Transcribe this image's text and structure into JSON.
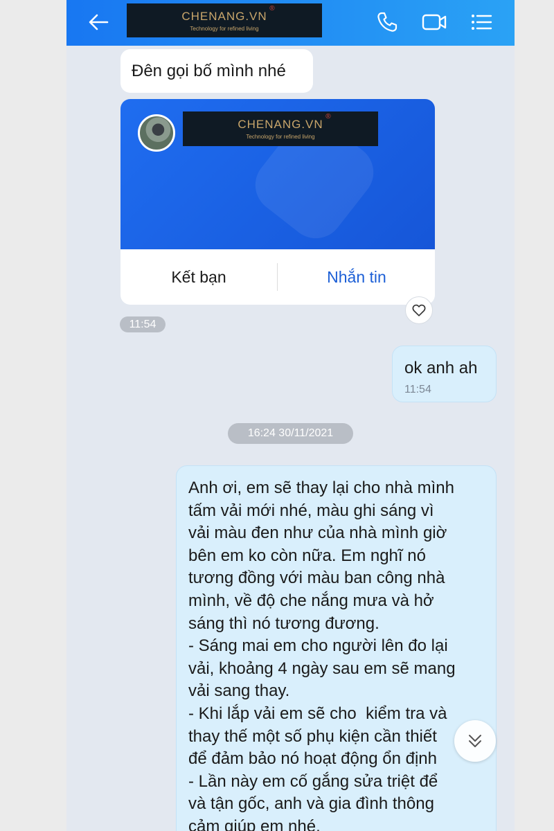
{
  "header": {
    "brand": {
      "name": "CHENANG.VN",
      "registered": "®",
      "tagline": "Technology for refined living"
    },
    "back_icon": "arrow-left-icon",
    "call_icon": "phone-icon",
    "video_icon": "video-camera-icon",
    "menu_icon": "list-menu-icon"
  },
  "messages": {
    "first": {
      "text": "Đên gọi bố mình nhé"
    },
    "contact_card": {
      "brand": {
        "name": "CHENANG.VN",
        "registered": "®",
        "tagline": "Technology for refined living"
      },
      "add_friend_label": "Kết bạn",
      "message_label": "Nhắn tin",
      "time": "11:54"
    },
    "reply": {
      "text": "ok anh ah",
      "time": "11:54"
    },
    "date_separator": "16:24 30/11/2021",
    "long_message": {
      "lines": [
        "Anh ơi, em sẽ thay lại cho nhà mình",
        "tấm vải mới nhé, màu ghi sáng vì",
        "vải màu đen như của nhà mình giờ",
        "bên em ko còn nữa. Em nghĩ nó",
        "tương đồng với màu ban công nhà",
        "mình, về độ che nắng mưa và hở",
        "sáng thì nó tương đương.",
        "- Sáng mai em cho người lên đo lại",
        "vải, khoảng 4 ngày sau em sẽ mang",
        "vải sang thay.",
        "- Khi lắp vải em sẽ cho  kiểm tra và",
        "thay thế một số phụ kiện cần thiết",
        "để đảm bảo nó hoạt động ổn định",
        "- Lần này em cố gắng sửa triệt để",
        "và tận gốc, anh và gia đình thông",
        "cảm giúp em nhé."
      ]
    }
  },
  "colors": {
    "header_gradient": [
      "#1877f2",
      "#2aa2f5"
    ],
    "chat_background": "#e3e8f0",
    "outgoing_bubble": "#d9effc",
    "card_blue": "#1f6df0",
    "link_blue": "#1c5fd6"
  }
}
